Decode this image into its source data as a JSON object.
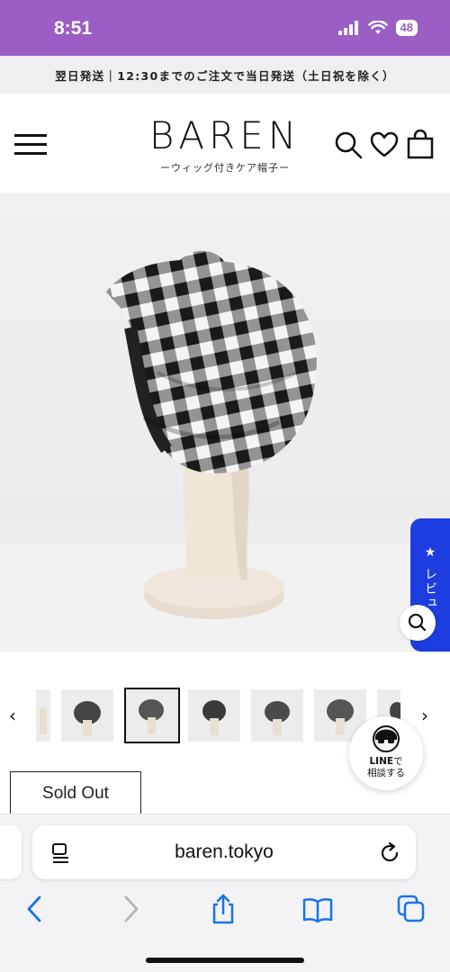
{
  "status_bar": {
    "time": "8:51",
    "battery": "48"
  },
  "announcement": "翌日発送｜12:30までのご注文で当日発送（土日祝を除く）",
  "header": {
    "logo": "BAREN",
    "tagline": "ーウィッグ付きケア帽子ー"
  },
  "review_tab": {
    "label": "★ レビュー"
  },
  "line_badge": {
    "line_word": "LINE",
    "suffix": "で",
    "line2": "相談する"
  },
  "product": {
    "status_button": "Sold Out"
  },
  "browser": {
    "url": "baren.tokyo"
  },
  "colors": {
    "status_bar": "#9a5ec4",
    "review_tab": "#1d3de0",
    "accent_text": "#111111"
  },
  "icons": [
    "menu-icon",
    "search-icon",
    "heart-icon",
    "bag-icon",
    "zoom-icon",
    "chevron-left-icon",
    "chevron-right-icon",
    "reader-icon",
    "reload-icon",
    "back-icon",
    "forward-icon",
    "share-icon",
    "bookmarks-icon",
    "tabs-icon"
  ]
}
